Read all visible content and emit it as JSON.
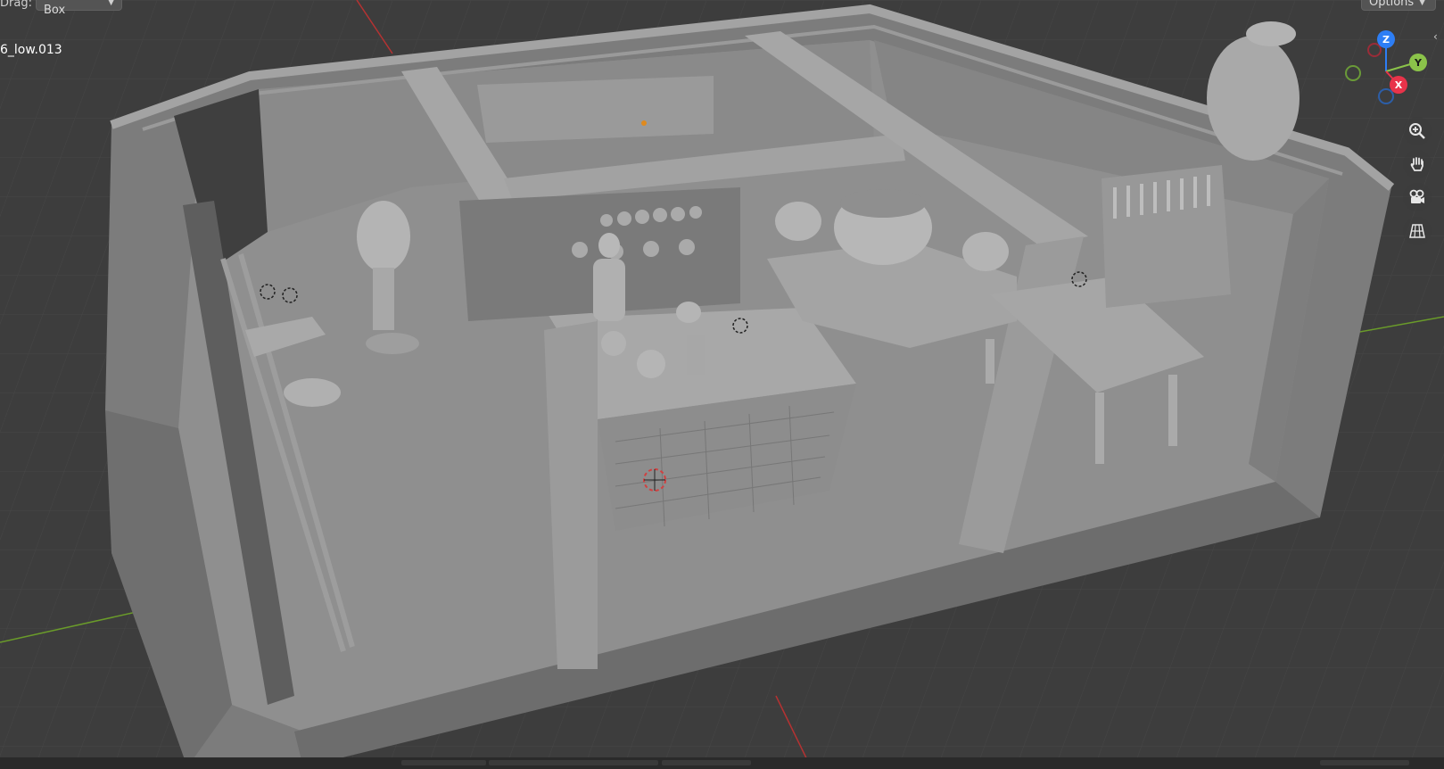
{
  "header": {
    "drag_label": "Drag:",
    "select_mode": "Select Box",
    "options_label": "Options"
  },
  "viewport": {
    "active_object_name": "6_low.013",
    "background_color": "#3d3d3d",
    "grid_color": "#444444",
    "x_axis_color": "#b53232",
    "y_axis_color": "#6a9b2a"
  },
  "gizmo": {
    "z_label": "Z",
    "y_label": "Y",
    "x_label": "X",
    "x_color": "#e8334a",
    "y_color": "#8bc34a",
    "z_color": "#2d7ef5"
  },
  "nav_buttons": {
    "zoom_icon": "zoom-in-icon",
    "pan_icon": "hand-icon",
    "camera_icon": "camera-icon",
    "ortho_icon": "grid-icon"
  }
}
